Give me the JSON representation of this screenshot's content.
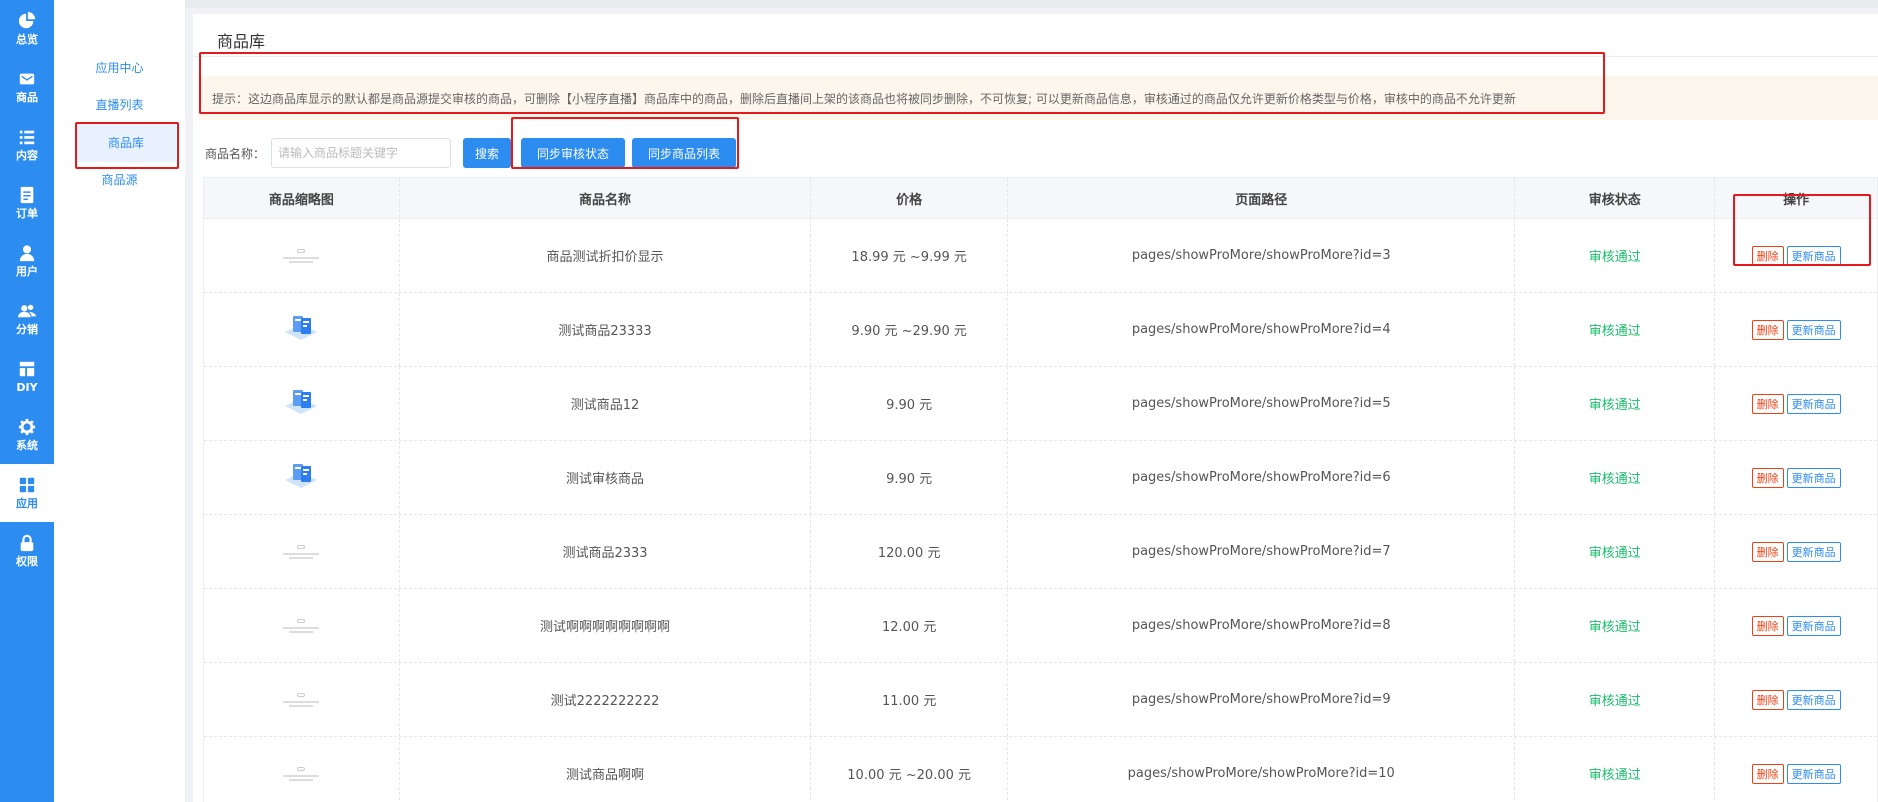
{
  "rail": [
    {
      "label": "总览",
      "icon": "pie-chart-icon"
    },
    {
      "label": "商品",
      "icon": "mail-icon"
    },
    {
      "label": "内容",
      "icon": "list-icon"
    },
    {
      "label": "订单",
      "icon": "document-icon"
    },
    {
      "label": "用户",
      "icon": "user-icon"
    },
    {
      "label": "分销",
      "icon": "users-icon"
    },
    {
      "label": "DIY",
      "icon": "layout-icon"
    },
    {
      "label": "系统",
      "icon": "gear-icon"
    },
    {
      "label": "应用",
      "icon": "grid-icon",
      "active": true
    },
    {
      "label": "权限",
      "icon": "lock-icon"
    }
  ],
  "submenu": [
    {
      "label": "应用中心"
    },
    {
      "label": "直播列表"
    },
    {
      "label": "商品库",
      "active": true
    },
    {
      "label": "商品源"
    }
  ],
  "page": {
    "title": "商品库",
    "notice": "提示：这边商品库显示的默认都是商品源提交审核的商品，可删除【小程序直播】商品库中的商品，删除后直播间上架的该商品也将被同步删除，不可恢复; 可以更新商品信息，审核通过的商品仅允许更新价格类型与价格，审核中的商品不允许更新"
  },
  "filter": {
    "label": "商品名称：",
    "placeholder": "请输入商品标题关键字",
    "search_btn": "搜索",
    "sync_status_btn": "同步审核状态",
    "sync_list_btn": "同步商品列表"
  },
  "table": {
    "headers": [
      "商品缩略图",
      "商品名称",
      "价格",
      "页面路径",
      "审核状态",
      "操作"
    ],
    "delete_label": "删除",
    "update_label": "更新商品",
    "rows": [
      {
        "thumb": "placeholder",
        "name": "商品测试折扣价显示",
        "price": "18.99 元 ~9.99 元",
        "path": "pages/showProMore/showProMore?id=3",
        "status": "审核通过"
      },
      {
        "thumb": "image",
        "name": "测试商品23333",
        "price": "9.90 元 ~29.90 元",
        "path": "pages/showProMore/showProMore?id=4",
        "status": "审核通过"
      },
      {
        "thumb": "image",
        "name": "测试商品12",
        "price": "9.90 元",
        "path": "pages/showProMore/showProMore?id=5",
        "status": "审核通过"
      },
      {
        "thumb": "image",
        "name": "测试审核商品",
        "price": "9.90 元",
        "path": "pages/showProMore/showProMore?id=6",
        "status": "审核通过"
      },
      {
        "thumb": "placeholder",
        "name": "测试商品2333",
        "price": "120.00 元",
        "path": "pages/showProMore/showProMore?id=7",
        "status": "审核通过"
      },
      {
        "thumb": "placeholder",
        "name": "测试啊啊啊啊啊啊啊啊",
        "price": "12.00 元",
        "path": "pages/showProMore/showProMore?id=8",
        "status": "审核通过"
      },
      {
        "thumb": "placeholder",
        "name": "测试2222222222",
        "price": "11.00 元",
        "path": "pages/showProMore/showProMore?id=9",
        "status": "审核通过"
      },
      {
        "thumb": "placeholder",
        "name": "测试商品啊啊",
        "price": "10.00 元 ~20.00 元",
        "path": "pages/showProMore/showProMore?id=10",
        "status": "审核通过"
      }
    ]
  },
  "colors": {
    "primary": "#2d8cf0",
    "success": "#19be6b",
    "danger": "#ed4014",
    "annotation": "#e4191c",
    "notice_bg": "#fdf6ec"
  }
}
